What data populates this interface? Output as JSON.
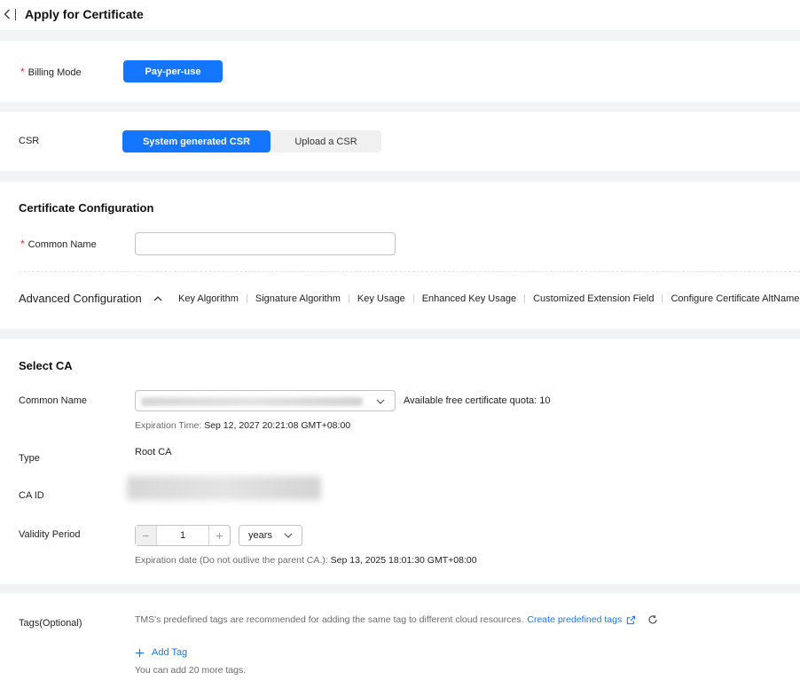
{
  "header": {
    "title": "Apply for Certificate"
  },
  "billing": {
    "label": "Billing Mode",
    "option": "Pay-per-use"
  },
  "csr": {
    "label": "CSR",
    "options": [
      "System generated CSR",
      "Upload a CSR"
    ]
  },
  "cert_config": {
    "title": "Certificate Configuration",
    "common_name_label": "Common Name",
    "common_name_value": "",
    "advanced_title": "Advanced Configuration",
    "advanced_items": [
      "Key Algorithm",
      "Signature Algorithm",
      "Key Usage",
      "Enhanced Key Usage",
      "Customized Extension Field",
      "Configure Certificate AltName"
    ]
  },
  "select_ca": {
    "title": "Select CA",
    "common_name_label": "Common Name",
    "quota_text": "Available free certificate quota: 10",
    "expiration_label": "Expiration Time:",
    "expiration_value": "Sep 12, 2027 20:21:08 GMT+08:00",
    "type_label": "Type",
    "type_value": "Root CA",
    "ca_id_label": "CA ID",
    "validity_label": "Validity Period",
    "validity_value": "1",
    "validity_unit": "years",
    "exp_date_label": "Expiration date (Do not outlive the parent CA.):",
    "exp_date_value": "Sep 13, 2025 18:01:30 GMT+08:00"
  },
  "tags": {
    "label": "Tags(Optional)",
    "hint": "TMS's predefined tags are recommended for adding the same tag to different cloud resources.",
    "create_link": "Create predefined tags",
    "add_tag": "Add Tag",
    "remaining": "You can add 20 more tags."
  },
  "icons": {
    "back": "chevron-left-icon",
    "collapse": "chevron-up-icon",
    "dropdown": "chevron-down-icon",
    "external": "external-link-icon",
    "refresh": "refresh-icon",
    "add": "plus-icon"
  },
  "colors": {
    "primary": "#1476ff",
    "required": "#e0333d",
    "background": "#f2f3f5"
  }
}
